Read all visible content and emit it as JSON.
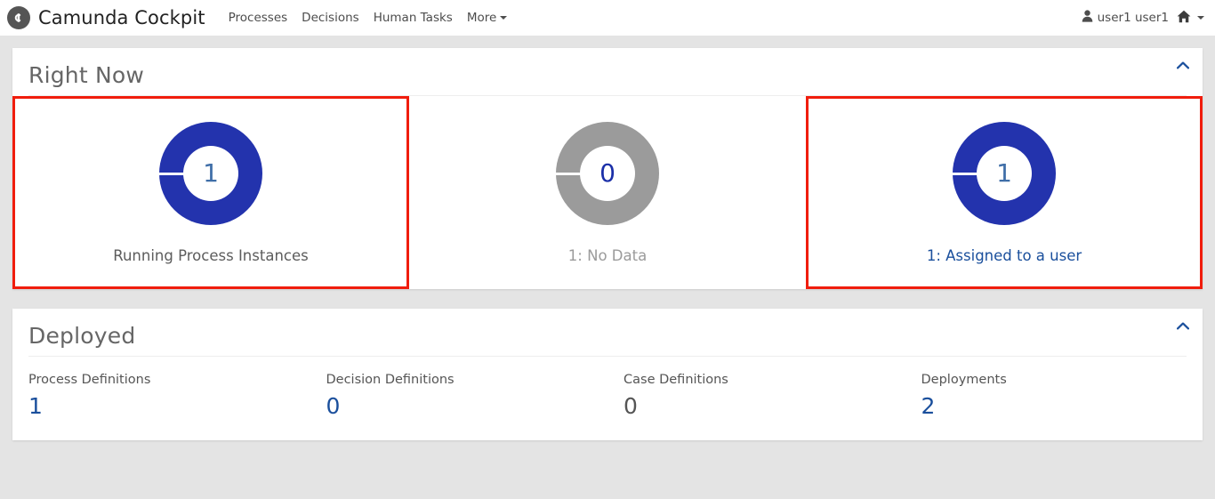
{
  "header": {
    "logo_icon": "camunda-logo-icon",
    "brand_title": "Camunda Cockpit",
    "nav_items": [
      {
        "label": "Processes"
      },
      {
        "label": "Decisions"
      },
      {
        "label": "Human Tasks"
      },
      {
        "label": "More",
        "has_caret": true
      }
    ],
    "user": {
      "icon": "user-icon",
      "name": "user1 user1"
    },
    "home": {
      "icon": "home-icon",
      "has_caret": true
    }
  },
  "right_now": {
    "title": "Right Now",
    "collapse_icon": "chevron-up-icon",
    "metrics": [
      {
        "value": "1",
        "label": "Running Process Instances",
        "color": "#2333ad",
        "value_color": "#3f6ea8",
        "label_style": "plain",
        "highlighted": true
      },
      {
        "value": "0",
        "label": "1: No Data",
        "color": "#9b9b9b",
        "value_color": "#1b2fa8",
        "label_style": "muted",
        "highlighted": false
      },
      {
        "value": "1",
        "label": "1: Assigned to a user",
        "color": "#2333ad",
        "value_color": "#3f6ea8",
        "label_style": "link",
        "highlighted": true
      }
    ]
  },
  "deployed": {
    "title": "Deployed",
    "collapse_icon": "chevron-up-icon",
    "stats": [
      {
        "label": "Process Definitions",
        "value": "1",
        "is_link": true
      },
      {
        "label": "Decision Definitions",
        "value": "0",
        "is_link": true
      },
      {
        "label": "Case Definitions",
        "value": "0",
        "is_link": false
      },
      {
        "label": "Deployments",
        "value": "2",
        "is_link": true
      }
    ]
  },
  "theme": {
    "accent_blue": "#2333ad",
    "link_blue": "#1a4f9c",
    "highlight_red": "#f01d0d",
    "page_background": "#e4e4e4",
    "card_background": "#ffffff"
  }
}
